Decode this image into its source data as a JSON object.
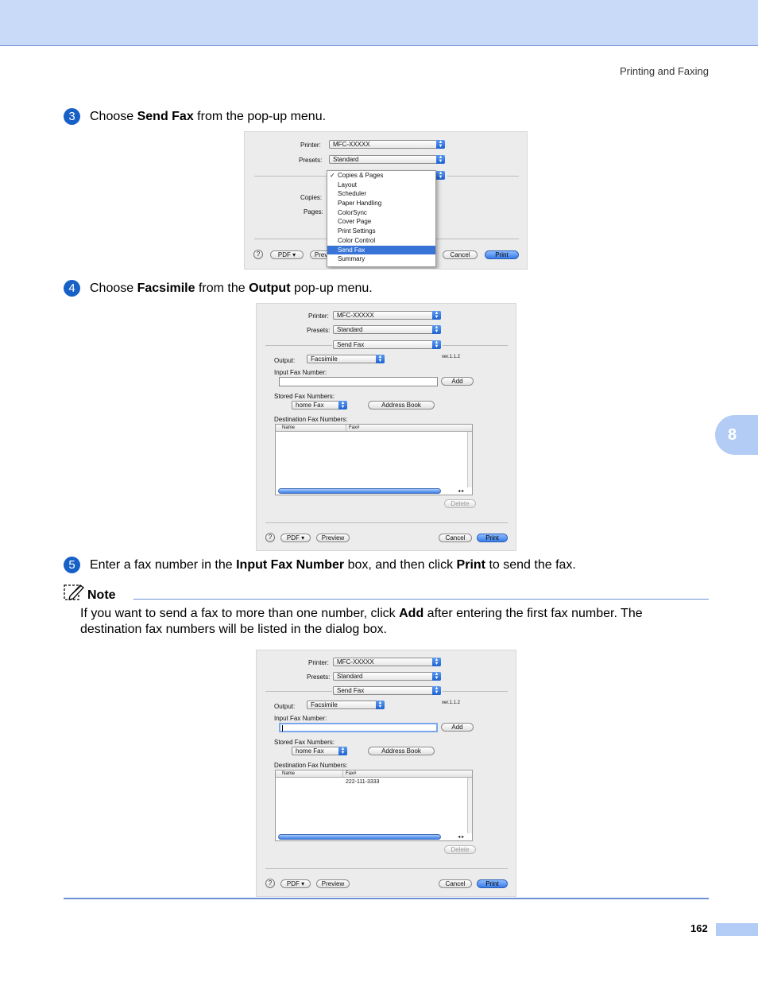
{
  "header": {
    "section": "Printing and Faxing"
  },
  "chapter_tab": "8",
  "steps": [
    {
      "num": "3",
      "pre": "Choose ",
      "b1": "Send Fax",
      "post": " from the pop-up menu."
    },
    {
      "num": "4",
      "pre": "Choose ",
      "b1": "Facsimile",
      "mid": " from the ",
      "b2": "Output",
      "post": " pop-up menu."
    },
    {
      "num": "5",
      "pre": "Enter a fax number in the ",
      "b1": "Input Fax Number",
      "mid": " box, and then click ",
      "b2": "Print",
      "post": " to send the fax."
    }
  ],
  "note": {
    "title": "Note",
    "line1_pre": "If you want to send a fax to more than one number, click ",
    "line1_bold": "Add",
    "line1_post": " after entering the first fax number. The",
    "line2": "destination fax numbers will be listed in the dialog box."
  },
  "dialog1": {
    "printer_label": "Printer:",
    "printer": "MFC-XXXXX",
    "presets_label": "Presets:",
    "presets": "Standard",
    "copies_label": "Copies:",
    "pages_label": "Pages:",
    "menu": [
      "Copies & Pages",
      "Layout",
      "Scheduler",
      "Paper Handling",
      "ColorSync",
      "Cover Page",
      "Print Settings",
      "Color Control",
      "Send Fax",
      "Summary"
    ],
    "menu_checked": "Copies & Pages",
    "menu_selected": "Send Fax",
    "help": "?",
    "pdf": "PDF ▾",
    "preview": "Previ",
    "cancel": "Cancel",
    "print": "Print"
  },
  "dialog2": {
    "printer_label": "Printer:",
    "printer": "MFC-XXXXX",
    "presets_label": "Presets:",
    "presets": "Standard",
    "panel": "Send Fax",
    "output_label": "Output:",
    "output": "Facsimile",
    "version": "ver.1.1.2",
    "input_label": "Input Fax Number:",
    "add": "Add",
    "stored_label": "Stored Fax Numbers:",
    "stored": "home Fax",
    "address_book": "Address Book",
    "dest_label": "Destination Fax Numbers:",
    "col_name": "Name",
    "col_fax": "Fax#",
    "delete": "Delete",
    "help": "?",
    "pdf": "PDF ▾",
    "preview": "Preview",
    "cancel": "Cancel",
    "print": "Print"
  },
  "dialog3": {
    "printer_label": "Printer:",
    "printer": "MFC-XXXXX",
    "presets_label": "Presets:",
    "presets": "Standard",
    "panel": "Send Fax",
    "output_label": "Output:",
    "output": "Facsimile",
    "version": "ver.1.1.2",
    "input_label": "Input Fax Number:",
    "add": "Add",
    "stored_label": "Stored Fax Numbers:",
    "stored": "home Fax",
    "address_book": "Address Book",
    "dest_label": "Destination Fax Numbers:",
    "col_name": "Name",
    "col_fax": "Fax#",
    "dest_fax": "222-111-3333",
    "delete": "Delete",
    "help": "?",
    "pdf": "PDF ▾",
    "preview": "Preview",
    "cancel": "Cancel",
    "print": "Print"
  },
  "footer": {
    "page_number": "162"
  }
}
